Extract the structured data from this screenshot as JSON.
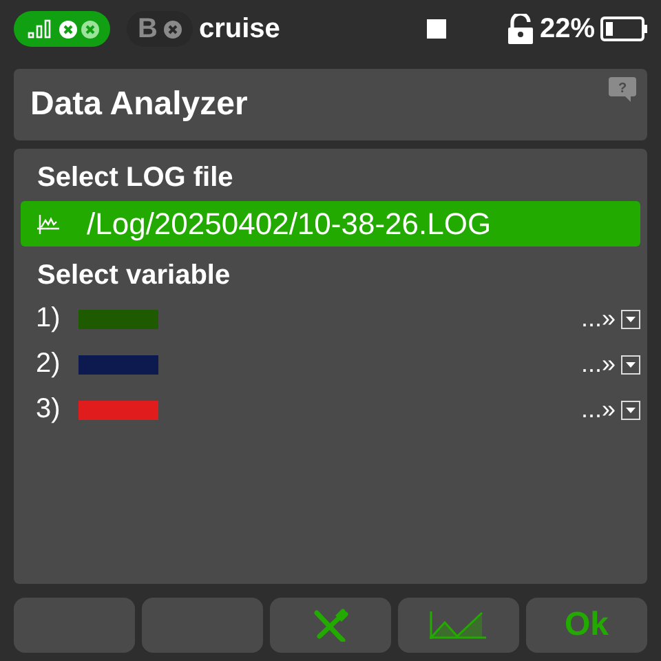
{
  "status_bar": {
    "model_badge": {
      "letter": "B"
    },
    "model_name": "cruise",
    "battery": "22%"
  },
  "window": {
    "title": "Data Analyzer",
    "help": "?"
  },
  "log_section": {
    "label": "Select LOG file",
    "file": {
      "path": "/Log/20250402/10-38-26.LOG",
      "selected": true
    }
  },
  "variable_section": {
    "label": "Select variable",
    "variables": [
      {
        "number": "1)",
        "color": "#1e5a00",
        "value": "...»"
      },
      {
        "number": "2)",
        "color": "#0c1a50",
        "value": "...»"
      },
      {
        "number": "3)",
        "color": "#e01c1c",
        "value": "...»"
      }
    ]
  },
  "buttons": [
    {
      "kind": "blank"
    },
    {
      "kind": "blank"
    },
    {
      "kind": "tools"
    },
    {
      "kind": "chart"
    },
    {
      "kind": "text",
      "label": "Ok"
    }
  ]
}
